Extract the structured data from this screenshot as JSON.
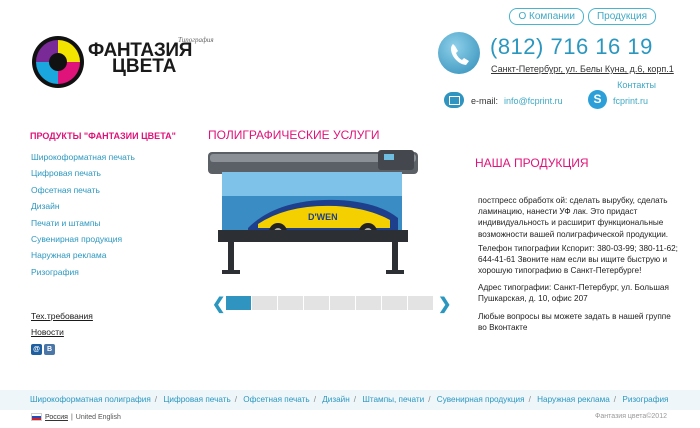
{
  "header": {
    "nav": [
      "О Компании",
      "Продукция"
    ],
    "logo": {
      "small_text": "Типография",
      "line1": "ФАНТАЗИЯ",
      "line2": "ЦВЕТА"
    },
    "phone": "(812) 716 16 19",
    "address": "Санкт-Петербург, ул. Белы Куна, д.6, корп.1",
    "contacts_link": "Контакты",
    "email_label": "e-mail:",
    "email": "info@fcprint.ru",
    "skype": "fcprint.ru",
    "icons": [
      "phone-icon",
      "email-icon",
      "skype-icon"
    ]
  },
  "sidebar": {
    "title": "ПРОДУКТЫ \"ФАНТАЗИИ ЦВЕТА\"",
    "items": [
      "Широкоформатная печать",
      "Цифровая печать",
      "Офсетная печать",
      "Дизайн",
      "Печати и штампы",
      "Сувенирная продукция",
      "Наружная реклама",
      "Ризография"
    ],
    "extra_links": [
      "Тех.требования",
      "Новости"
    ],
    "social": [
      "mail-ru-icon",
      "vk-icon"
    ]
  },
  "main": {
    "title": "ПОЛИГРАФИЧЕСКИЕ УСЛУГИ",
    "slider": {
      "prev": "❮",
      "next": "❯",
      "slide_count": 8,
      "active_index": 0
    }
  },
  "right": {
    "title": "НАША ПРОДУКЦИЯ",
    "paragraphs": [
      "постпресс обработк ой: сделать вырубку, сделать ламинацию, нанести УФ лак. Это придаст индивидуальность и расширит функциональные возможности вашей полиграфической продукции.",
      "Телефон типографии Кспорит: 380-03-99; 380-11-62; 644-41-61 Звоните нам если вы ищите быструю и хорошую типографию в Санкт-Петербурге!",
      "Адрес типографии: Санкт-Петербург, ул. Большая Пушкарская, д. 10, офис 207",
      "Любые вопросы вы можете задать в нашей группе во Вконтакте"
    ]
  },
  "footer": {
    "links": [
      "Широкоформатная полиграфия",
      "Цифровая печать",
      "Офсетная печать",
      "Дизайн",
      "Штампы, печати",
      "Сувенирная продукция",
      "Наружная реклама",
      "Ризография"
    ],
    "separator": "/",
    "lang_active": "Россия",
    "lang_divider": "|",
    "lang_other": "United English",
    "copyright": "Фантазия цвета©2012"
  },
  "colors": {
    "accent_pink": "#e0137a",
    "accent_blue": "#2b97bf",
    "slider_active": "#2f95c0"
  }
}
